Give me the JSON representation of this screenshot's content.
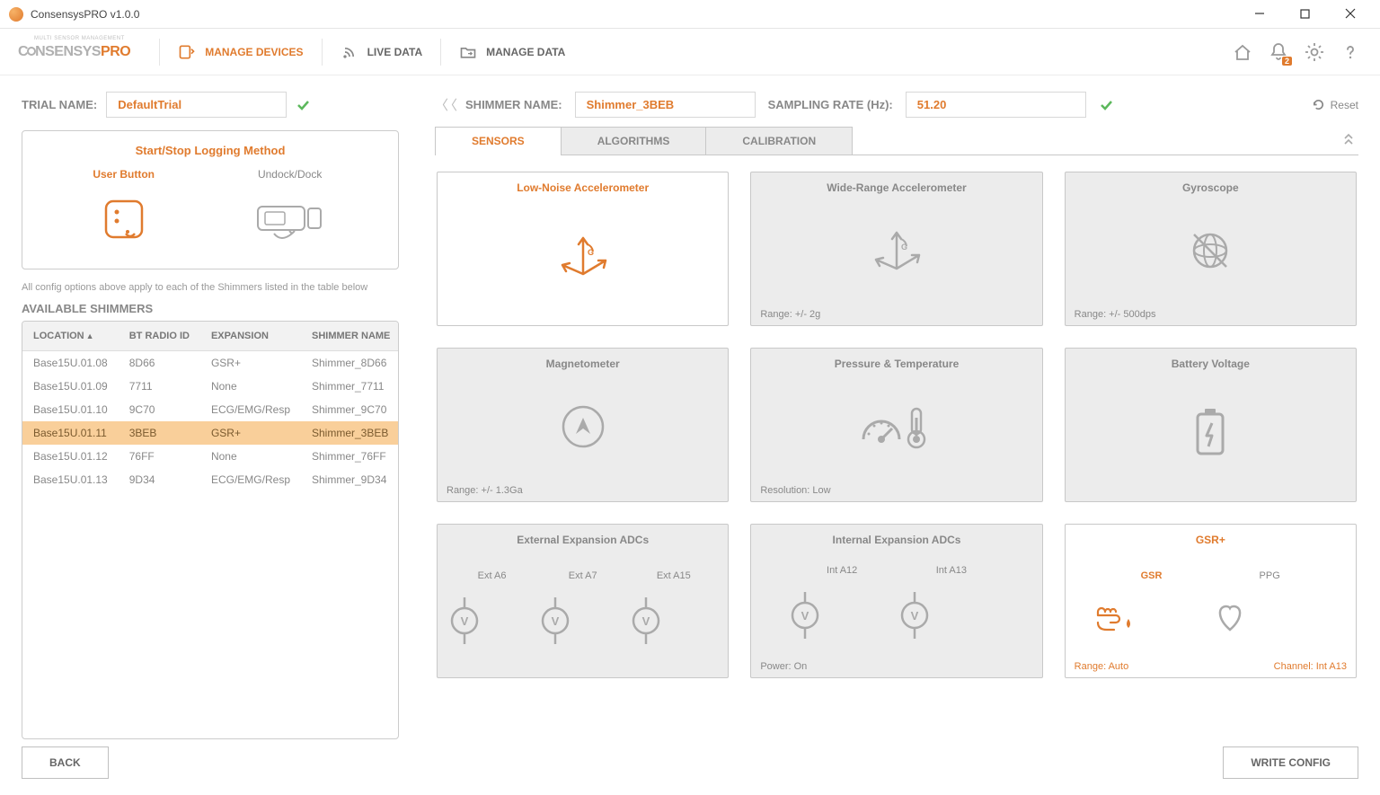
{
  "window": {
    "title": "ConsensysPRO v1.0.0"
  },
  "brand": {
    "name": "CONSENSYS",
    "suffix": "PRO",
    "tagline": "MULTI SENSOR MANAGEMENT"
  },
  "nav": {
    "manage_devices": "MANAGE DEVICES",
    "live_data": "LIVE DATA",
    "manage_data": "MANAGE DATA"
  },
  "toolbar_badge": "2",
  "trial": {
    "label": "TRIAL NAME:",
    "value": "DefaultTrial"
  },
  "logging": {
    "title": "Start/Stop Logging Method",
    "user_button": "User Button",
    "undock_dock": "Undock/Dock"
  },
  "note": "All config options above apply to each of the Shimmers listed in the table below",
  "available_header": "AVAILABLE SHIMMERS",
  "table": {
    "cols": {
      "location": "LOCATION",
      "bt": "BT RADIO ID",
      "exp": "EXPANSION",
      "name": "SHIMMER NAME"
    },
    "rows": [
      {
        "location": "Base15U.01.08",
        "bt": "8D66",
        "exp": "GSR+",
        "name": "Shimmer_8D66"
      },
      {
        "location": "Base15U.01.09",
        "bt": "7711",
        "exp": "None",
        "name": "Shimmer_7711"
      },
      {
        "location": "Base15U.01.10",
        "bt": "9C70",
        "exp": "ECG/EMG/Resp",
        "name": "Shimmer_9C70"
      },
      {
        "location": "Base15U.01.11",
        "bt": "3BEB",
        "exp": "GSR+",
        "name": "Shimmer_3BEB"
      },
      {
        "location": "Base15U.01.12",
        "bt": "76FF",
        "exp": "None",
        "name": "Shimmer_76FF"
      },
      {
        "location": "Base15U.01.13",
        "bt": "9D34",
        "exp": "ECG/EMG/Resp",
        "name": "Shimmer_9D34"
      }
    ],
    "selected_index": 3
  },
  "shimmer": {
    "name_label": "SHIMMER NAME:",
    "name_value": "Shimmer_3BEB",
    "rate_label": "SAMPLING RATE (Hz):",
    "rate_value": "51.20",
    "reset": "Reset"
  },
  "tabs": {
    "sensors": "SENSORS",
    "algorithms": "ALGORITHMS",
    "calibration": "CALIBRATION"
  },
  "sensors": {
    "low_noise": {
      "title": "Low-Noise Accelerometer"
    },
    "wide_range": {
      "title": "Wide-Range Accelerometer",
      "footer_left": "Range: +/- 2g"
    },
    "gyro": {
      "title": "Gyroscope",
      "footer_left": "Range: +/- 500dps"
    },
    "mag": {
      "title": "Magnetometer",
      "footer_left": "Range: +/- 1.3Ga"
    },
    "pressure": {
      "title": "Pressure & Temperature",
      "footer_left": "Resolution: Low"
    },
    "battery": {
      "title": "Battery Voltage"
    },
    "ext_adc": {
      "title": "External Expansion ADCs",
      "a": "Ext A6",
      "b": "Ext A7",
      "c": "Ext A15"
    },
    "int_adc": {
      "title": "Internal Expansion ADCs",
      "a": "Int A12",
      "b": "Int A13",
      "footer_left": "Power: On"
    },
    "gsr": {
      "title": "GSR+",
      "a": "GSR",
      "b": "PPG",
      "footer_left": "Range: Auto",
      "footer_right": "Channel: Int A13"
    }
  },
  "footer": {
    "back": "BACK",
    "write": "WRITE CONFIG"
  }
}
